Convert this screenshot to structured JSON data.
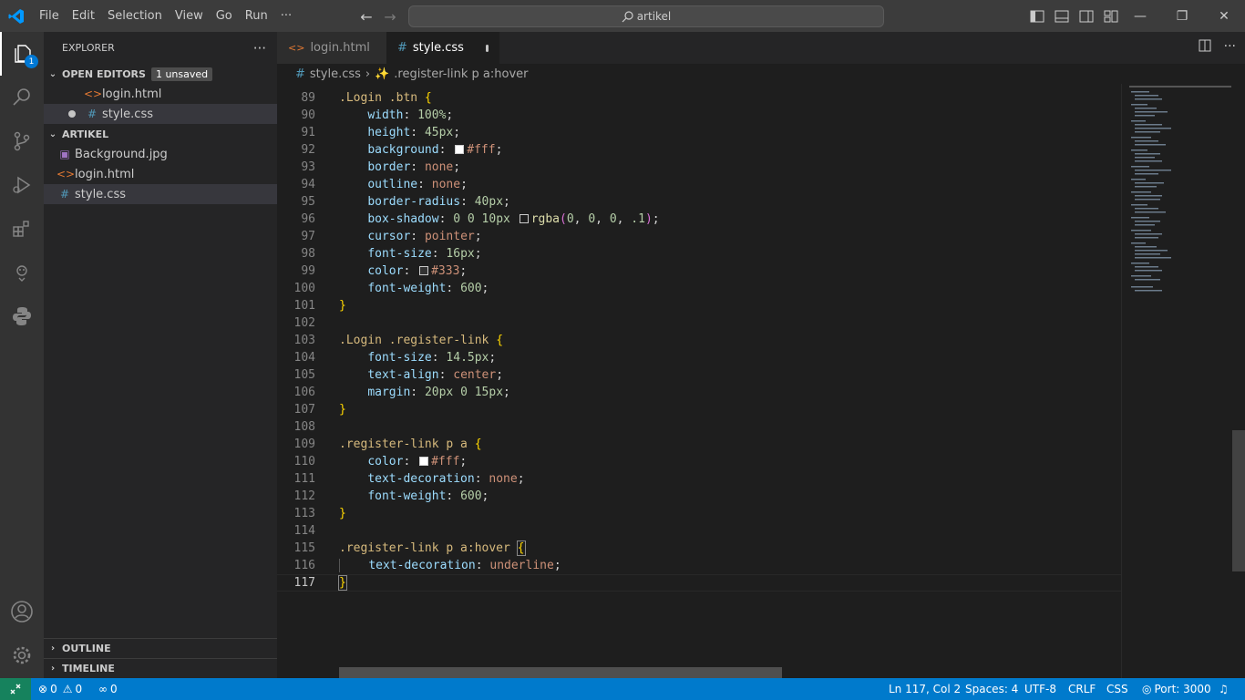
{
  "titlebar": {
    "menu": [
      "File",
      "Edit",
      "Selection",
      "View",
      "Go",
      "Run",
      "···"
    ],
    "search_text": "artikel"
  },
  "activity": {
    "explorer_badge": "1"
  },
  "sidebar": {
    "title": "EXPLORER",
    "more": "···",
    "open_editors": {
      "label": "OPEN EDITORS",
      "badge": "1 unsaved",
      "files": [
        "login.html",
        "style.css"
      ]
    },
    "project": {
      "label": "ARTIKEL",
      "files": [
        "Background.jpg",
        "login.html",
        "style.css"
      ]
    },
    "outline_label": "OUTLINE",
    "timeline_label": "TIMELINE"
  },
  "tabs": [
    {
      "label": "login.html"
    },
    {
      "label": "style.css"
    }
  ],
  "breadcrumb": {
    "file": "style.css",
    "symbol": ".register-link p a:hover"
  },
  "editor": {
    "line_numbers": [
      "89",
      "90",
      "91",
      "92",
      "93",
      "94",
      "95",
      "96",
      "97",
      "98",
      "99",
      "100",
      "101",
      "102",
      "103",
      "104",
      "105",
      "106",
      "107",
      "108",
      "109",
      "110",
      "111",
      "112",
      "113",
      "114",
      "115",
      "116",
      "117"
    ]
  },
  "status": {
    "errors": "0",
    "warnings": "0",
    "ports": "0",
    "position": "Ln 117, Col 2",
    "spaces": "Spaces: 4",
    "encoding": "UTF-8",
    "eol": "CRLF",
    "language": "CSS",
    "port": "Port: 3000"
  },
  "colors": {
    "accent": "#007acc",
    "remote": "#16825d",
    "background": "#1e1e1e",
    "sidebar": "#252526"
  }
}
